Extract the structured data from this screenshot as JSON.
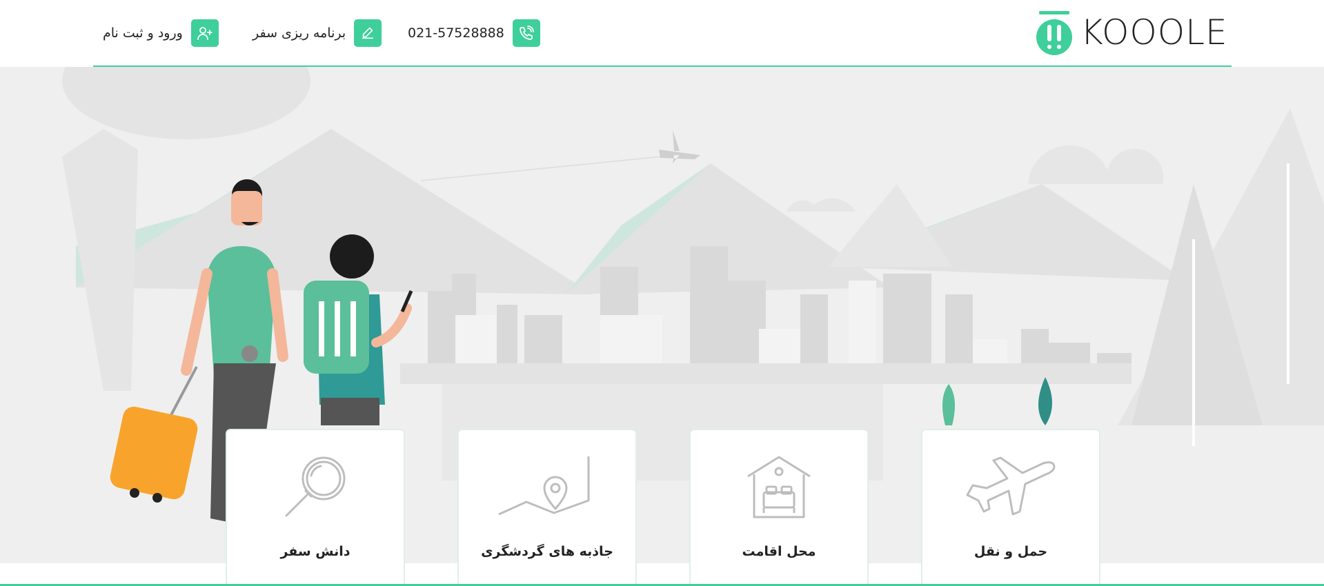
{
  "header": {
    "logo_text": "KOOOLE",
    "phone": "021-57528888",
    "phone_icon": "phone-icon",
    "trip_planning_label": "برنامه ریزی سفر",
    "trip_planning_icon": "pencil-icon",
    "login_label": "ورود و ثبت نام",
    "login_icon": "add-user-icon"
  },
  "cards": [
    {
      "label": "حمل و نقل",
      "icon": "airplane-icon"
    },
    {
      "label": "محل اقامت",
      "icon": "hotel-icon"
    },
    {
      "label": "جاذبه های گردشگری",
      "icon": "map-pin-icon"
    },
    {
      "label": "دانش سفر",
      "icon": "magnifier-icon"
    }
  ],
  "colors": {
    "accent": "#3ecf9a",
    "background": "#efefef",
    "text": "#222222"
  }
}
